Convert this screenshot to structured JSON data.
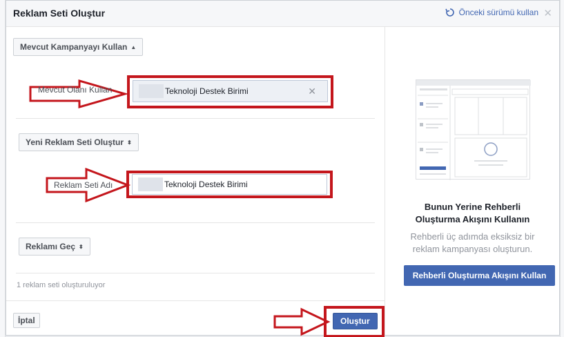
{
  "dialog": {
    "title": "Reklam Seti Oluştur",
    "previous_version": "Önceki sürümü kullan",
    "close": "✕"
  },
  "campaign": {
    "dropdown_label": "Mevcut Kampanyayı Kullan",
    "field_label": "Mevcut Olanı Kullan",
    "value": "Teknoloji Destek Birimi"
  },
  "adset": {
    "dropdown_label": "Yeni Reklam Seti Oluştur",
    "field_label": "Reklam Seti Adı",
    "value": "Teknoloji Destek Birimi"
  },
  "ad": {
    "dropdown_label": "Reklamı Geç"
  },
  "status": "1 reklam seti oluşturuluyor",
  "footer": {
    "cancel": "İptal",
    "create": "Oluştur"
  },
  "guided": {
    "title_line1": "Bunun Yerine Rehberli",
    "title_line2": "Oluşturma Akışını Kullanın",
    "desc_line1": "Rehberli üç adımda eksiksiz bir",
    "desc_line2": "reklam kampanyası oluşturun.",
    "button": "Rehberli Oluşturma Akışını Kullan"
  },
  "colors": {
    "accent": "#4267b2",
    "annotation_red": "#c4161c"
  }
}
